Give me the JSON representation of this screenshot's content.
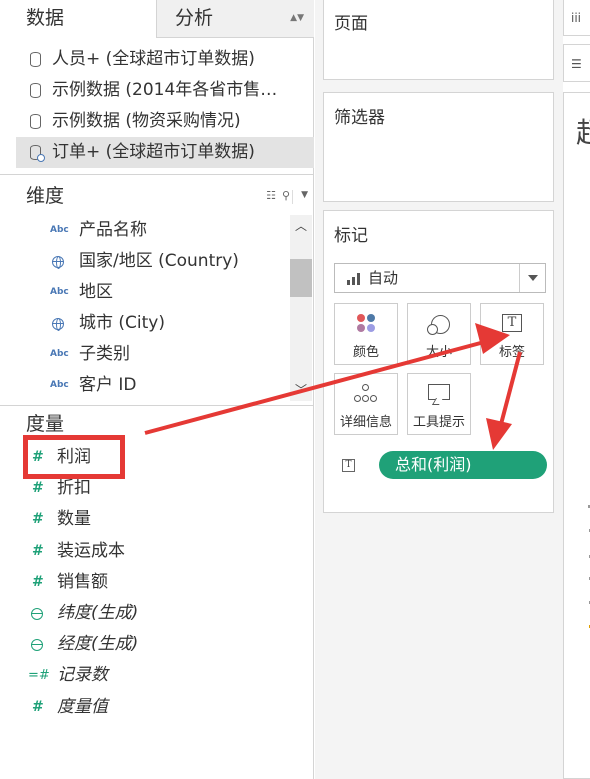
{
  "tabs": {
    "data": "数据",
    "analysis": "分析"
  },
  "datasources": [
    {
      "label": "人员+ (全球超市订单数据)"
    },
    {
      "label": "示例数据 (2014年各省市售…"
    },
    {
      "label": "示例数据 (物资采购情况)"
    },
    {
      "label": "订单+ (全球超市订单数据)"
    }
  ],
  "dimensions": {
    "title": "维度",
    "items": [
      {
        "label": "产品名称",
        "type": "Abc"
      },
      {
        "label": "国家/地区 (Country)",
        "type": "globe"
      },
      {
        "label": "地区",
        "type": "Abc"
      },
      {
        "label": "城市 (City)",
        "type": "globe"
      },
      {
        "label": "子类别",
        "type": "Abc"
      },
      {
        "label": "客户 ID",
        "type": "Abc"
      }
    ]
  },
  "measures": {
    "title": "度量",
    "items": [
      {
        "label": "利润",
        "type": "hash"
      },
      {
        "label": "折扣",
        "type": "hash"
      },
      {
        "label": "数量",
        "type": "hash"
      },
      {
        "label": "装运成本",
        "type": "hash"
      },
      {
        "label": "销售额",
        "type": "hash"
      },
      {
        "label": "纬度(生成)",
        "type": "globe"
      },
      {
        "label": "经度(生成)",
        "type": "globe"
      },
      {
        "label": "记录数",
        "type": "hash-eq"
      },
      {
        "label": "度量值",
        "type": "hash"
      }
    ]
  },
  "cards": {
    "pages": "页面",
    "filters": "筛选器",
    "marks": "标记"
  },
  "marks": {
    "type": "自动",
    "buttons": {
      "color": "颜色",
      "size": "大小",
      "label": "标签",
      "detail": "详细信息",
      "tooltip": "工具提示"
    },
    "label_icon_glyph": "T",
    "pill_icon_glyph": "T",
    "pill": "总和(利润)",
    "pill_color": "#1fa178"
  },
  "view": {
    "title_fragment": "超"
  },
  "colors": {
    "accent_red": "#e53935",
    "measure_green": "#1fa178",
    "dimension_blue": "#4a78b5"
  }
}
